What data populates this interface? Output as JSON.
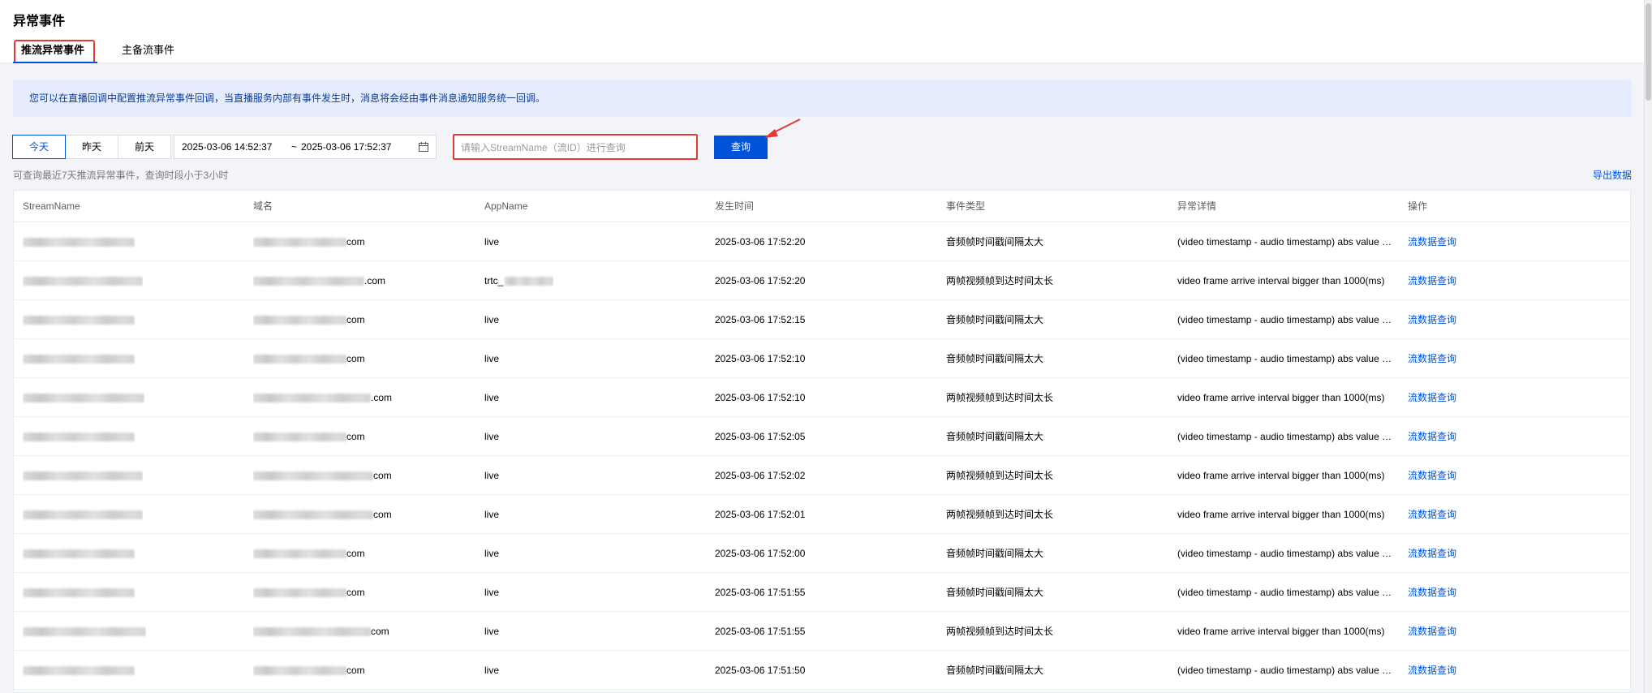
{
  "page_title": "异常事件",
  "tabs": [
    {
      "label": "推流异常事件",
      "active": true
    },
    {
      "label": "主备流事件",
      "active": false
    }
  ],
  "notice": "您可以在直播回调中配置推流异常事件回调，当直播服务内部有事件发生时，消息将会经由事件消息通知服务统一回调。",
  "filters": {
    "days": [
      "今天",
      "昨天",
      "前天"
    ],
    "active_day": "今天",
    "date_start": "2025-03-06 14:52:37",
    "date_separator": "~",
    "date_end": "2025-03-06 17:52:37",
    "search_placeholder": "请输入StreamName（流ID）进行查询",
    "query_label": "查询"
  },
  "hint": "可查询最近7天推流异常事件，查询时段小于3小时",
  "export_label": "导出数据",
  "table": {
    "columns": [
      "StreamName",
      "域名",
      "AppName",
      "发生时间",
      "事件类型",
      "异常详情",
      "操作"
    ],
    "rows": [
      {
        "domain_suffix": "com",
        "app": "live",
        "time": "2025-03-06 17:52:20",
        "type": "音频帧时间戳间隔太大",
        "detail": "(video timestamp - audio timestamp) abs value is too big",
        "action": "流数据查询"
      },
      {
        "domain_suffix": ".com",
        "app": "trtc_",
        "time": "2025-03-06 17:52:20",
        "type": "两帧视频帧到达时间太长",
        "detail": "video frame arrive interval bigger than 1000(ms)",
        "action": "流数据查询"
      },
      {
        "domain_suffix": "com",
        "app": "live",
        "time": "2025-03-06 17:52:15",
        "type": "音频帧时间戳间隔太大",
        "detail": "(video timestamp - audio timestamp) abs value is too big",
        "action": "流数据查询"
      },
      {
        "domain_suffix": "com",
        "app": "live",
        "time": "2025-03-06 17:52:10",
        "type": "音频帧时间戳间隔太大",
        "detail": "(video timestamp - audio timestamp) abs value is too big",
        "action": "流数据查询"
      },
      {
        "domain_suffix": ".com",
        "app": "live",
        "time": "2025-03-06 17:52:10",
        "type": "两帧视频帧到达时间太长",
        "detail": "video frame arrive interval bigger than 1000(ms)",
        "action": "流数据查询"
      },
      {
        "domain_suffix": "com",
        "app": "live",
        "time": "2025-03-06 17:52:05",
        "type": "音频帧时间戳间隔太大",
        "detail": "(video timestamp - audio timestamp) abs value is too big",
        "action": "流数据查询"
      },
      {
        "domain_suffix": "com",
        "app": "live",
        "time": "2025-03-06 17:52:02",
        "type": "两帧视频帧到达时间太长",
        "detail": "video frame arrive interval bigger than 1000(ms)",
        "action": "流数据查询"
      },
      {
        "domain_suffix": "com",
        "app": "live",
        "time": "2025-03-06 17:52:01",
        "type": "两帧视频帧到达时间太长",
        "detail": "video frame arrive interval bigger than 1000(ms)",
        "action": "流数据查询"
      },
      {
        "domain_suffix": "com",
        "app": "live",
        "time": "2025-03-06 17:52:00",
        "type": "音频帧时间戳间隔太大",
        "detail": "(video timestamp - audio timestamp) abs value is too big",
        "action": "流数据查询"
      },
      {
        "domain_suffix": "com",
        "app": "live",
        "time": "2025-03-06 17:51:55",
        "type": "音频帧时间戳间隔太大",
        "detail": "(video timestamp - audio timestamp) abs value is too big",
        "action": "流数据查询"
      },
      {
        "domain_suffix": "com",
        "app": "live",
        "time": "2025-03-06 17:51:55",
        "type": "两帧视频帧到达时间太长",
        "detail": "video frame arrive interval bigger than 1000(ms)",
        "action": "流数据查询"
      },
      {
        "domain_suffix": "com",
        "app": "live",
        "time": "2025-03-06 17:51:50",
        "type": "音频帧时间戳间隔太大",
        "detail": "(video timestamp - audio timestamp) abs value is too big",
        "action": "流数据查询"
      }
    ]
  },
  "colors": {
    "accent": "#0052d9",
    "highlight_box": "#e53935",
    "notice_bg": "#e4ecfd"
  }
}
